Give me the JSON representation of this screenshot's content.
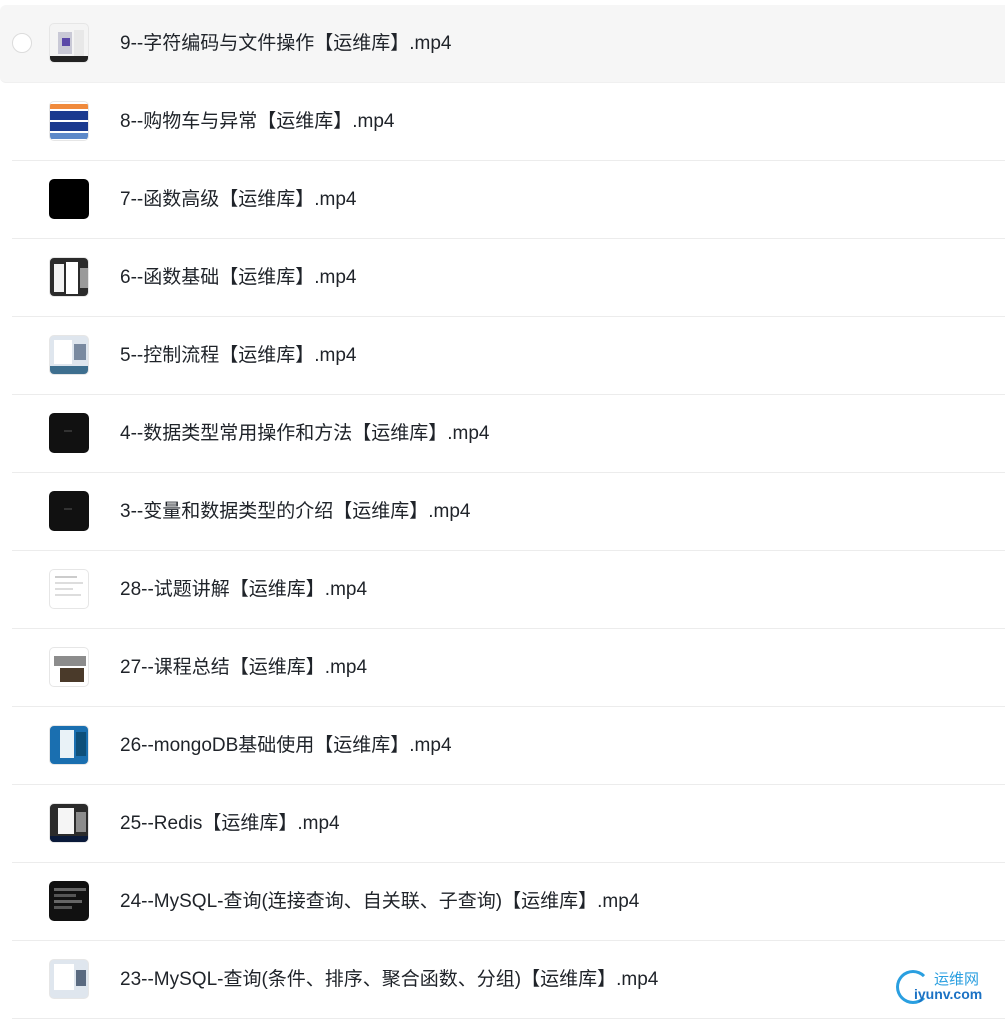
{
  "files": [
    {
      "name": "9--字符编码与文件操作【运维库】.mp4",
      "thumb": "light"
    },
    {
      "name": "8--购物车与异常【运维库】.mp4",
      "thumb": "doc"
    },
    {
      "name": "7--函数高级【运维库】.mp4",
      "thumb": "black"
    },
    {
      "name": "6--函数基础【运维库】.mp4",
      "thumb": "mixed"
    },
    {
      "name": "5--控制流程【运维库】.mp4",
      "thumb": "shot"
    },
    {
      "name": "4--数据类型常用操作和方法【运维库】.mp4",
      "thumb": "dark"
    },
    {
      "name": "3--变量和数据类型的介绍【运维库】.mp4",
      "thumb": "dark"
    },
    {
      "name": "28--试题讲解【运维库】.mp4",
      "thumb": "doc"
    },
    {
      "name": "27--课程总结【运维库】.mp4",
      "thumb": "shot"
    },
    {
      "name": "26--mongoDB基础使用【运维库】.mp4",
      "thumb": "blue"
    },
    {
      "name": "25--Redis【运维库】.mp4",
      "thumb": "mixed"
    },
    {
      "name": "24--MySQL-查询(连接查询、自关联、子查询)【运维库】.mp4",
      "thumb": "dark"
    },
    {
      "name": "23--MySQL-查询(条件、排序、聚合函数、分组)【运维库】.mp4",
      "thumb": "shot"
    }
  ],
  "watermark": {
    "top": "运维网",
    "bottom": "iyunv.com"
  }
}
